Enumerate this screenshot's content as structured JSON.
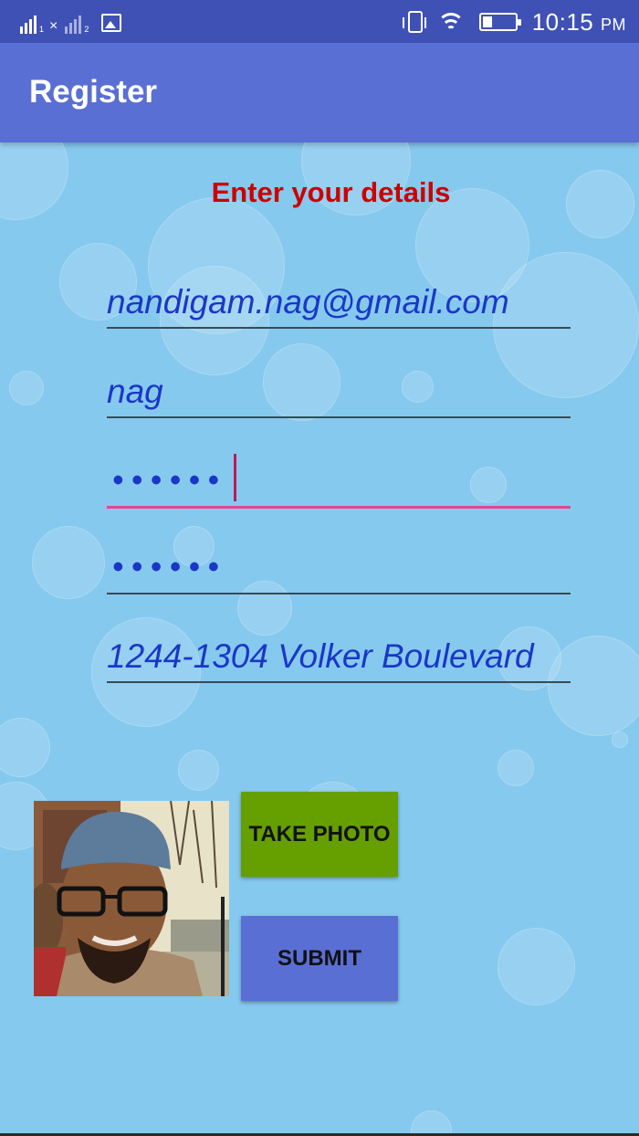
{
  "status_bar": {
    "time": "10:15",
    "ampm": "PM",
    "sim1": "1",
    "sim2": "2",
    "icons": [
      "signal-icon",
      "no-signal-icon",
      "image-notification-icon",
      "vibrate-icon",
      "wifi-icon",
      "battery-icon"
    ]
  },
  "app_bar": {
    "title": "Register"
  },
  "form": {
    "heading": "Enter your details",
    "email": "nandigam.nag@gmail.com",
    "name": "nag",
    "password_mask": "••••••",
    "confirm_password_mask": "••••••",
    "address": "1244-1304 Volker Boulevard"
  },
  "buttons": {
    "take_photo": "TAKE PHOTO",
    "submit": "SUBMIT"
  },
  "colors": {
    "status_bar": "#3f51b5",
    "app_bar": "#5a6fd4",
    "background": "#86c9ee",
    "heading": "#cc0000",
    "field_text": "#1a37c8",
    "focus_underline": "#e5458a",
    "take_photo_button": "#669f00",
    "submit_button": "#5a6fd4"
  }
}
